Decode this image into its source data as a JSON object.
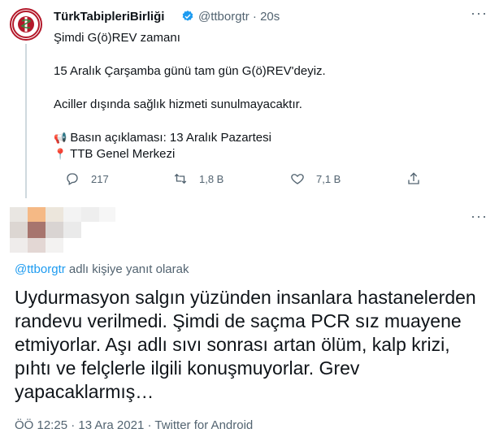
{
  "tweet": {
    "author_name": "TürkTabipleriBirliği",
    "handle": "@ttborgtr",
    "time": "20s",
    "separator": "·",
    "lines": [
      "Şimdi G(ö)REV zamanı",
      "15 Aralık Çarşamba günü tam gün G(ö)REV'deyiz.",
      "Aciller dışında sağlık hizmeti sunulmayacaktır.",
      "Basın açıklaması: 13 Aralık Pazartesi",
      "TTB Genel Merkezi"
    ],
    "icons": {
      "megaphone": "📢",
      "pin": "📍"
    },
    "actions": {
      "replies": "217",
      "retweets": "1,8 B",
      "likes": "7,1 B"
    },
    "more": "···"
  },
  "reply": {
    "replying_to_handle": "@ttborgtr",
    "replying_to_suffix": " adlı kişiye yanıt olarak",
    "text": "Uydurmasyon salgın yüzünden insanlara hastanelerden randevu verilmedi. Şimdi de saçma PCR sız muayene etmiyorlar. Aşı adlı sıvı sonrası artan ölüm, kalp krizi, pıhtı ve felçlerle ilgili konuşmuyorlar. Grev yapacaklarmış…",
    "time": "ÖÖ 12:25",
    "dot": "·",
    "date": "13 Ara 2021",
    "source": "Twitter for Android",
    "more": "···"
  },
  "colors": {
    "accent": "#1d9bf0",
    "text": "#0f1419",
    "muted": "#536471",
    "brand_red": "#b3182a"
  }
}
